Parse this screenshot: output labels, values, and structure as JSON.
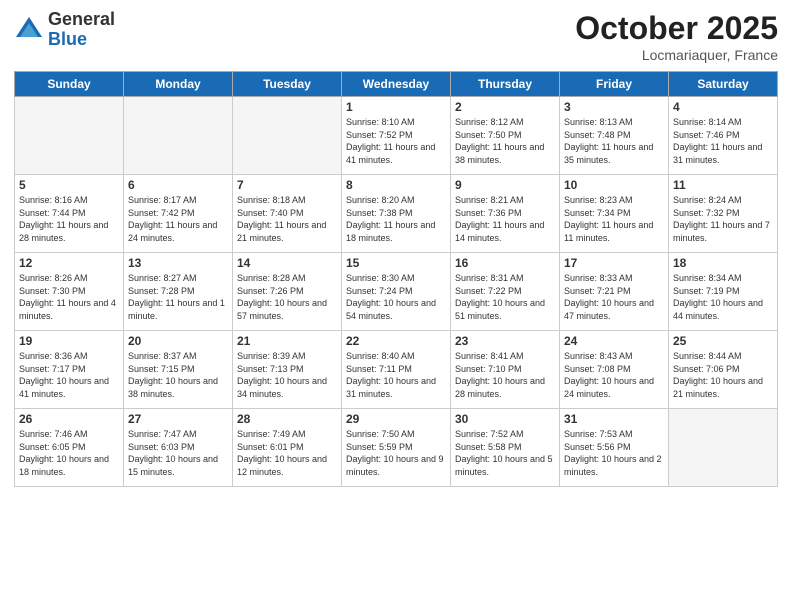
{
  "header": {
    "logo_general": "General",
    "logo_blue": "Blue",
    "month_title": "October 2025",
    "location": "Locmariaquer, France"
  },
  "days_of_week": [
    "Sunday",
    "Monday",
    "Tuesday",
    "Wednesday",
    "Thursday",
    "Friday",
    "Saturday"
  ],
  "weeks": [
    [
      {
        "day": "",
        "sunrise": "",
        "sunset": "",
        "daylight": "",
        "empty": true
      },
      {
        "day": "",
        "sunrise": "",
        "sunset": "",
        "daylight": "",
        "empty": true
      },
      {
        "day": "",
        "sunrise": "",
        "sunset": "",
        "daylight": "",
        "empty": true
      },
      {
        "day": "1",
        "sunrise": "Sunrise: 8:10 AM",
        "sunset": "Sunset: 7:52 PM",
        "daylight": "Daylight: 11 hours and 41 minutes."
      },
      {
        "day": "2",
        "sunrise": "Sunrise: 8:12 AM",
        "sunset": "Sunset: 7:50 PM",
        "daylight": "Daylight: 11 hours and 38 minutes."
      },
      {
        "day": "3",
        "sunrise": "Sunrise: 8:13 AM",
        "sunset": "Sunset: 7:48 PM",
        "daylight": "Daylight: 11 hours and 35 minutes."
      },
      {
        "day": "4",
        "sunrise": "Sunrise: 8:14 AM",
        "sunset": "Sunset: 7:46 PM",
        "daylight": "Daylight: 11 hours and 31 minutes."
      }
    ],
    [
      {
        "day": "5",
        "sunrise": "Sunrise: 8:16 AM",
        "sunset": "Sunset: 7:44 PM",
        "daylight": "Daylight: 11 hours and 28 minutes."
      },
      {
        "day": "6",
        "sunrise": "Sunrise: 8:17 AM",
        "sunset": "Sunset: 7:42 PM",
        "daylight": "Daylight: 11 hours and 24 minutes."
      },
      {
        "day": "7",
        "sunrise": "Sunrise: 8:18 AM",
        "sunset": "Sunset: 7:40 PM",
        "daylight": "Daylight: 11 hours and 21 minutes."
      },
      {
        "day": "8",
        "sunrise": "Sunrise: 8:20 AM",
        "sunset": "Sunset: 7:38 PM",
        "daylight": "Daylight: 11 hours and 18 minutes."
      },
      {
        "day": "9",
        "sunrise": "Sunrise: 8:21 AM",
        "sunset": "Sunset: 7:36 PM",
        "daylight": "Daylight: 11 hours and 14 minutes."
      },
      {
        "day": "10",
        "sunrise": "Sunrise: 8:23 AM",
        "sunset": "Sunset: 7:34 PM",
        "daylight": "Daylight: 11 hours and 11 minutes."
      },
      {
        "day": "11",
        "sunrise": "Sunrise: 8:24 AM",
        "sunset": "Sunset: 7:32 PM",
        "daylight": "Daylight: 11 hours and 7 minutes."
      }
    ],
    [
      {
        "day": "12",
        "sunrise": "Sunrise: 8:26 AM",
        "sunset": "Sunset: 7:30 PM",
        "daylight": "Daylight: 11 hours and 4 minutes."
      },
      {
        "day": "13",
        "sunrise": "Sunrise: 8:27 AM",
        "sunset": "Sunset: 7:28 PM",
        "daylight": "Daylight: 11 hours and 1 minute."
      },
      {
        "day": "14",
        "sunrise": "Sunrise: 8:28 AM",
        "sunset": "Sunset: 7:26 PM",
        "daylight": "Daylight: 10 hours and 57 minutes."
      },
      {
        "day": "15",
        "sunrise": "Sunrise: 8:30 AM",
        "sunset": "Sunset: 7:24 PM",
        "daylight": "Daylight: 10 hours and 54 minutes."
      },
      {
        "day": "16",
        "sunrise": "Sunrise: 8:31 AM",
        "sunset": "Sunset: 7:22 PM",
        "daylight": "Daylight: 10 hours and 51 minutes."
      },
      {
        "day": "17",
        "sunrise": "Sunrise: 8:33 AM",
        "sunset": "Sunset: 7:21 PM",
        "daylight": "Daylight: 10 hours and 47 minutes."
      },
      {
        "day": "18",
        "sunrise": "Sunrise: 8:34 AM",
        "sunset": "Sunset: 7:19 PM",
        "daylight": "Daylight: 10 hours and 44 minutes."
      }
    ],
    [
      {
        "day": "19",
        "sunrise": "Sunrise: 8:36 AM",
        "sunset": "Sunset: 7:17 PM",
        "daylight": "Daylight: 10 hours and 41 minutes."
      },
      {
        "day": "20",
        "sunrise": "Sunrise: 8:37 AM",
        "sunset": "Sunset: 7:15 PM",
        "daylight": "Daylight: 10 hours and 38 minutes."
      },
      {
        "day": "21",
        "sunrise": "Sunrise: 8:39 AM",
        "sunset": "Sunset: 7:13 PM",
        "daylight": "Daylight: 10 hours and 34 minutes."
      },
      {
        "day": "22",
        "sunrise": "Sunrise: 8:40 AM",
        "sunset": "Sunset: 7:11 PM",
        "daylight": "Daylight: 10 hours and 31 minutes."
      },
      {
        "day": "23",
        "sunrise": "Sunrise: 8:41 AM",
        "sunset": "Sunset: 7:10 PM",
        "daylight": "Daylight: 10 hours and 28 minutes."
      },
      {
        "day": "24",
        "sunrise": "Sunrise: 8:43 AM",
        "sunset": "Sunset: 7:08 PM",
        "daylight": "Daylight: 10 hours and 24 minutes."
      },
      {
        "day": "25",
        "sunrise": "Sunrise: 8:44 AM",
        "sunset": "Sunset: 7:06 PM",
        "daylight": "Daylight: 10 hours and 21 minutes."
      }
    ],
    [
      {
        "day": "26",
        "sunrise": "Sunrise: 7:46 AM",
        "sunset": "Sunset: 6:05 PM",
        "daylight": "Daylight: 10 hours and 18 minutes."
      },
      {
        "day": "27",
        "sunrise": "Sunrise: 7:47 AM",
        "sunset": "Sunset: 6:03 PM",
        "daylight": "Daylight: 10 hours and 15 minutes."
      },
      {
        "day": "28",
        "sunrise": "Sunrise: 7:49 AM",
        "sunset": "Sunset: 6:01 PM",
        "daylight": "Daylight: 10 hours and 12 minutes."
      },
      {
        "day": "29",
        "sunrise": "Sunrise: 7:50 AM",
        "sunset": "Sunset: 5:59 PM",
        "daylight": "Daylight: 10 hours and 9 minutes."
      },
      {
        "day": "30",
        "sunrise": "Sunrise: 7:52 AM",
        "sunset": "Sunset: 5:58 PM",
        "daylight": "Daylight: 10 hours and 5 minutes."
      },
      {
        "day": "31",
        "sunrise": "Sunrise: 7:53 AM",
        "sunset": "Sunset: 5:56 PM",
        "daylight": "Daylight: 10 hours and 2 minutes."
      },
      {
        "day": "",
        "sunrise": "",
        "sunset": "",
        "daylight": "",
        "empty": true
      }
    ]
  ]
}
